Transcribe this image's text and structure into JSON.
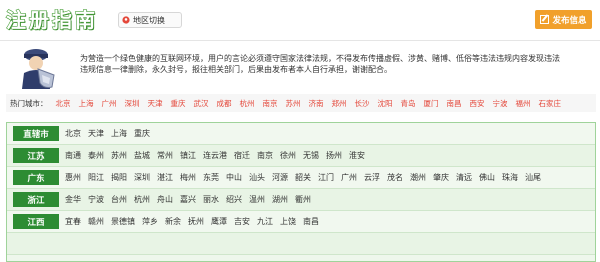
{
  "header": {
    "site_title": "注册指南",
    "region_switch": "地区切换",
    "publish_button": "发布信息"
  },
  "notice": {
    "text": "为营造一个绿色健康的互联网环境，用户的言论必须遵守国家法律法规，不得发布传播虚假、涉黄、赌博、低俗等违法违规内容发现违法违规信息一律删除，永久封号，报往相关部门，后果由发布者本人自行承担，谢谢配合。"
  },
  "hot_cities": {
    "label": "热门城市：",
    "items": [
      "北京",
      "上海",
      "广州",
      "深圳",
      "天津",
      "重庆",
      "武汉",
      "成都",
      "杭州",
      "南京",
      "苏州",
      "济南",
      "郑州",
      "长沙",
      "沈阳",
      "青岛",
      "厦门",
      "南昌",
      "西安",
      "宁波",
      "福州",
      "石家庄"
    ]
  },
  "provinces": [
    {
      "name": "直辖市",
      "cities": [
        "北京",
        "天津",
        "上海",
        "重庆"
      ]
    },
    {
      "name": "江苏",
      "cities": [
        "南通",
        "泰州",
        "苏州",
        "盐城",
        "常州",
        "镇江",
        "连云港",
        "宿迁",
        "南京",
        "徐州",
        "无锡",
        "扬州",
        "淮安"
      ]
    },
    {
      "name": "广东",
      "cities": [
        "惠州",
        "阳江",
        "揭阳",
        "深圳",
        "湛江",
        "梅州",
        "东莞",
        "中山",
        "汕头",
        "河源",
        "韶关",
        "江门",
        "广州",
        "云浮",
        "茂名",
        "潮州",
        "肇庆",
        "清远",
        "佛山",
        "珠海",
        "汕尾"
      ]
    },
    {
      "name": "浙江",
      "cities": [
        "金华",
        "宁波",
        "台州",
        "杭州",
        "舟山",
        "嘉兴",
        "丽水",
        "绍兴",
        "温州",
        "湖州",
        "衢州"
      ]
    },
    {
      "name": "江西",
      "cities": [
        "宜春",
        "赣州",
        "景德镇",
        "萍乡",
        "新余",
        "抚州",
        "鹰潭",
        "吉安",
        "九江",
        "上饶",
        "南昌"
      ]
    },
    {
      "name": "",
      "cities": []
    }
  ],
  "colors": {
    "accent_green": "#2d8c33",
    "hot_link_red": "#e4473a",
    "publish_orange": "#f1a02b"
  }
}
